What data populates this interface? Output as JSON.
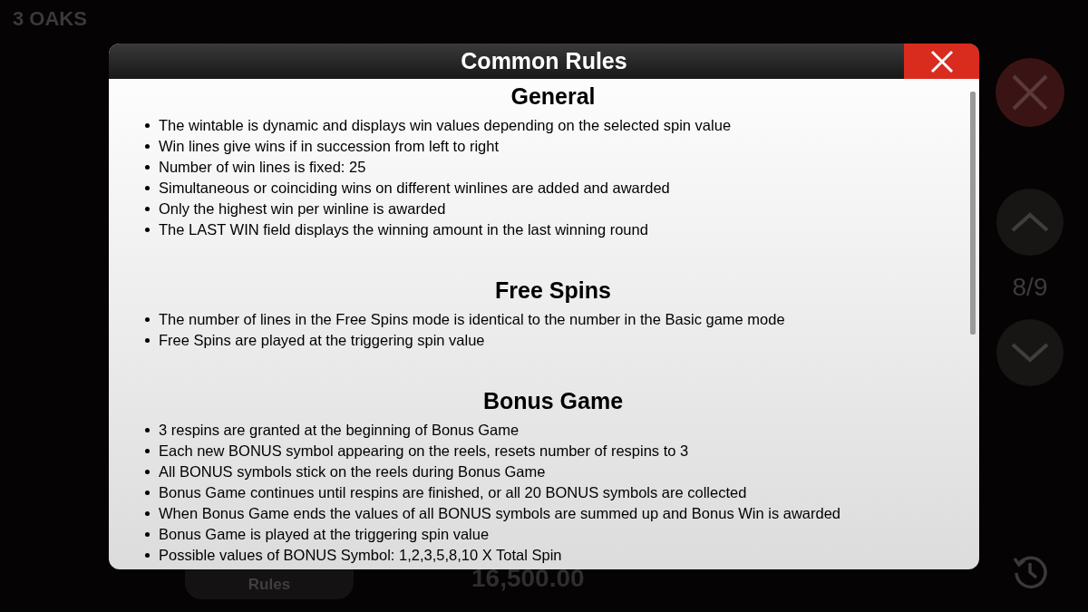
{
  "brand": "3 OAKS",
  "side_controls": {
    "page_indicator": "8/9"
  },
  "bottom": {
    "rules_button": "Rules",
    "amount": "16,500.00"
  },
  "dialog": {
    "title": "Common Rules",
    "sections": [
      {
        "heading": "General",
        "items": [
          "The wintable is dynamic and displays win values depending on the selected spin value",
          "Win lines give wins if in succession from left to right",
          "Number of win lines is fixed: 25",
          "Simultaneous or coinciding wins on different winlines are added and awarded",
          "Only the highest win per winline is awarded",
          "The LAST WIN field displays the winning amount in the last winning round"
        ]
      },
      {
        "heading": "Free Spins",
        "items": [
          "The number of lines in the Free Spins mode is identical to the number in the Basic game mode",
          "Free Spins are played at the triggering spin value"
        ]
      },
      {
        "heading": "Bonus Game",
        "items": [
          "3 respins are granted at the beginning of Bonus Game",
          "Each new BONUS symbol appearing on the reels, resets number of respins to 3",
          "All BONUS symbols stick on the reels during Bonus Game",
          "Bonus Game continues until respins are finished, or all 20 BONUS symbols are collected",
          "When Bonus Game ends the values of all BONUS symbols are summed up and Bonus Win is awarded",
          "Bonus Game is played at the triggering spin value",
          "Possible values of BONUS Symbol: 1,2,3,5,8,10 X Total Spin"
        ]
      }
    ]
  }
}
